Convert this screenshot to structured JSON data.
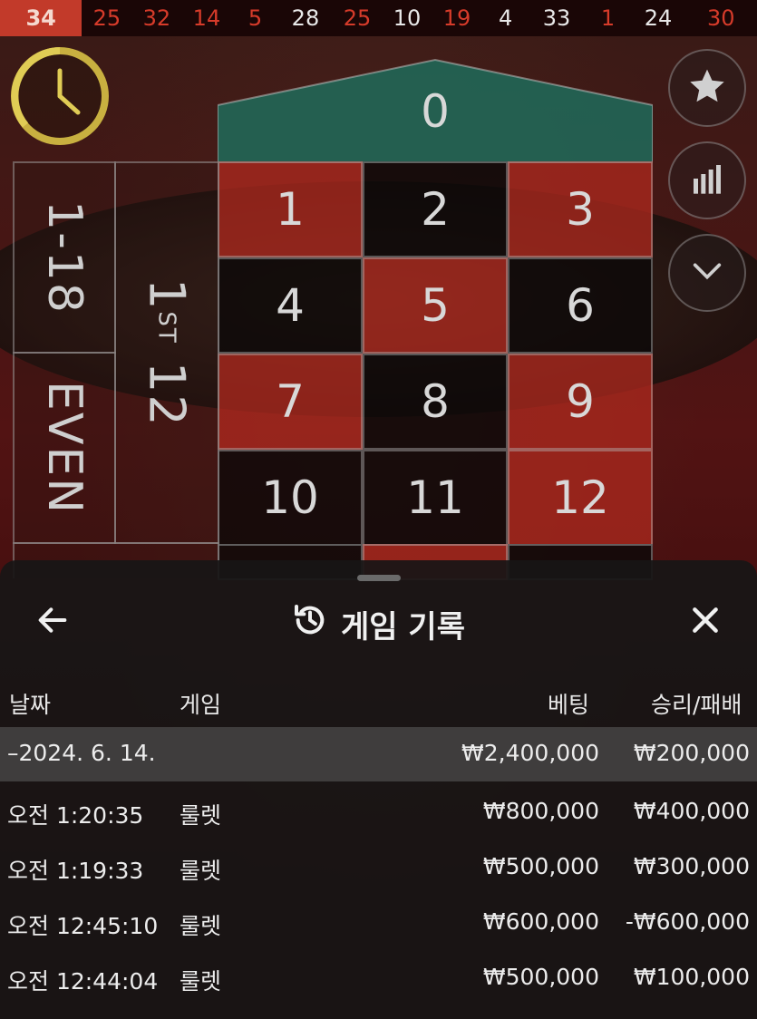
{
  "results_strip": [
    {
      "n": "34",
      "c": "red"
    },
    {
      "n": "25",
      "c": "red"
    },
    {
      "n": "32",
      "c": "red"
    },
    {
      "n": "14",
      "c": "red"
    },
    {
      "n": "5",
      "c": "red"
    },
    {
      "n": "28",
      "c": "black"
    },
    {
      "n": "25",
      "c": "red"
    },
    {
      "n": "10",
      "c": "black"
    },
    {
      "n": "19",
      "c": "red"
    },
    {
      "n": "4",
      "c": "black"
    },
    {
      "n": "33",
      "c": "black"
    },
    {
      "n": "1",
      "c": "red"
    },
    {
      "n": "24",
      "c": "black"
    },
    {
      "n": "30",
      "c": "red"
    }
  ],
  "table": {
    "zero": "0",
    "numbers": [
      {
        "n": "1",
        "c": "red"
      },
      {
        "n": "2",
        "c": "black"
      },
      {
        "n": "3",
        "c": "red"
      },
      {
        "n": "4",
        "c": "black"
      },
      {
        "n": "5",
        "c": "red"
      },
      {
        "n": "6",
        "c": "black"
      },
      {
        "n": "7",
        "c": "red"
      },
      {
        "n": "8",
        "c": "black"
      },
      {
        "n": "9",
        "c": "red"
      },
      {
        "n": "10",
        "c": "black"
      },
      {
        "n": "11",
        "c": "black"
      },
      {
        "n": "12",
        "c": "red"
      }
    ],
    "low_label": "1-18",
    "even_label": "EVEN",
    "dozen_label_main": "1",
    "dozen_label_sup": "ST",
    "dozen_label_tail": "12"
  },
  "side_buttons": {
    "favorite_icon": "star-icon",
    "stats_icon": "bar-chart-icon",
    "collapse_icon": "chevron-down-icon"
  },
  "history": {
    "title": "게임 기록",
    "back_icon": "arrow-left-icon",
    "close_icon": "close-icon",
    "columns": {
      "date": "날짜",
      "game": "게임",
      "bet": "베팅",
      "result": "승리/패배"
    },
    "summary": {
      "date": "–2024. 6. 14.",
      "bet": "₩2,400,000",
      "result": "₩200,000"
    },
    "rows": [
      {
        "time": "오전 1:20:35",
        "game": "룰렛",
        "bet": "₩800,000",
        "result": "₩400,000"
      },
      {
        "time": "오전 1:19:33",
        "game": "룰렛",
        "bet": "₩500,000",
        "result": "₩300,000"
      },
      {
        "time": "오전 12:45:10",
        "game": "룰렛",
        "bet": "₩600,000",
        "result": "-₩600,000"
      },
      {
        "time": "오전 12:44:04",
        "game": "룰렛",
        "bet": "₩500,000",
        "result": "₩100,000"
      }
    ]
  },
  "colors": {
    "red": "#aa281e",
    "black": "#0c0808",
    "felt_green": "#1f6b5a",
    "timer_gold": "#c8b040"
  }
}
